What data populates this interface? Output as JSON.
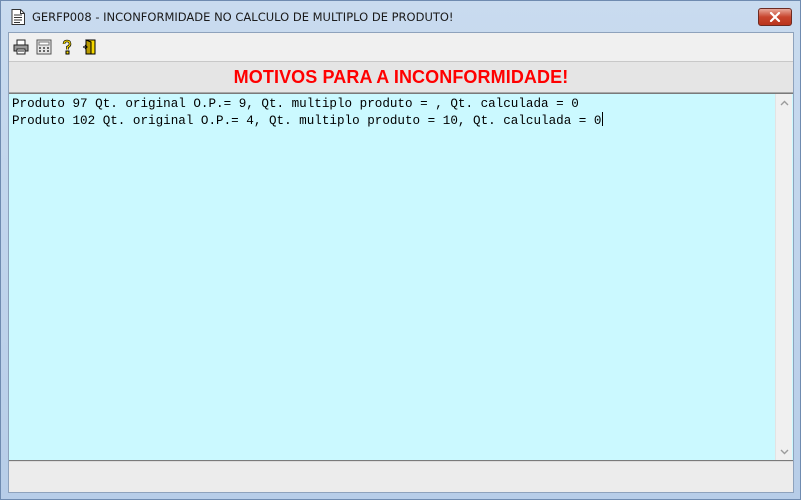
{
  "window": {
    "title": "GERFP008 - INCONFORMIDADE NO CALCULO DE MULTIPLO DE PRODUTO!",
    "icon": "document-icon"
  },
  "toolbar": {
    "buttons": [
      {
        "name": "print",
        "icon": "printer-icon"
      },
      {
        "name": "calculator",
        "icon": "calculator-icon"
      },
      {
        "name": "help",
        "icon": "question-icon"
      },
      {
        "name": "exit",
        "icon": "exit-door-icon"
      }
    ]
  },
  "header": {
    "title": "MOTIVOS PARA A INCONFORMIDADE!",
    "color": "#ff0000"
  },
  "memo": {
    "background": "#cbf9ff",
    "lines": [
      "Produto 97 Qt. original O.P.= 9, Qt. multiplo produto = , Qt. calculada = 0",
      "Produto 102 Qt. original O.P.= 4, Qt. multiplo produto = 10, Qt. calculada = 0"
    ]
  }
}
